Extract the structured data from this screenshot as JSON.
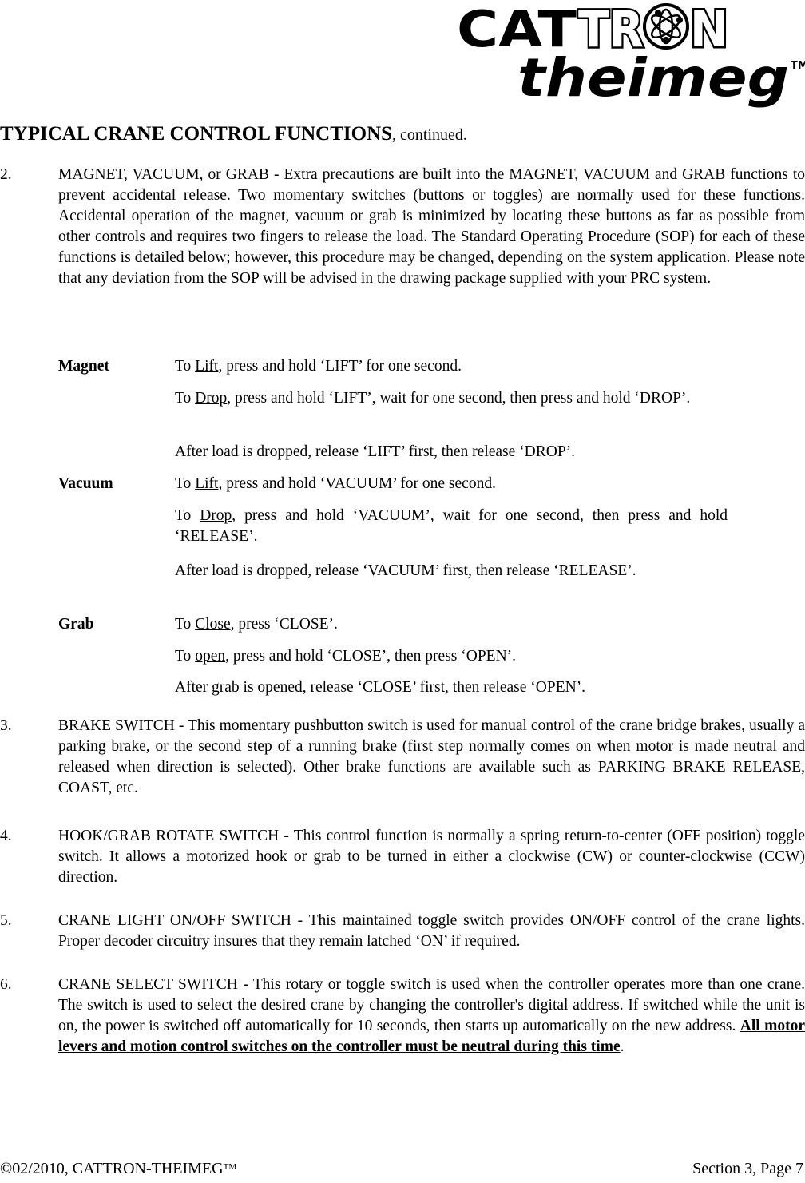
{
  "logo": {
    "line1": "CATTRON",
    "line2": "theimeg",
    "trademark": "TM"
  },
  "heading": {
    "bold": "TYPICAL CRANE CONTROL FUNCTIONS",
    "suffix": ", continued."
  },
  "items": [
    {
      "number": "2.",
      "text": "MAGNET, VACUUM, or GRAB - Extra precautions are built into the MAGNET, VACUUM and GRAB functions to prevent accidental release.  Two momentary switches (buttons or toggles) are normally used for these functions.  Accidental operation of the magnet, vacuum or grab is minimized by locating these buttons as far as possible from other controls and requires two fingers to release the load.  The Standard Operating Procedure (SOP) for each of these functions is detailed below; however, this procedure may be changed, depending on the system application.  Please note that any deviation from the SOP will be advised in the drawing package supplied with your PRC system."
    },
    {
      "number": "3.",
      "text": "BRAKE SWITCH - This momentary pushbutton switch is used for manual control of the crane bridge brakes, usually a parking brake, or the second step of a running brake (first step normally comes on when motor is made neutral and released when direction is selected). Other brake functions are available such as PARKING BRAKE RELEASE, COAST, etc."
    },
    {
      "number": "4.",
      "text": "HOOK/GRAB ROTATE SWITCH - This control function is normally a spring return-to-center (OFF position) toggle switch.  It allows a motorized hook or grab to be turned in either a clockwise (CW) or counter-clockwise (CCW) direction."
    },
    {
      "number": "5.",
      "text": "CRANE LIGHT ON/OFF SWITCH - This maintained toggle switch provides ON/OFF control of the crane lights.  Proper decoder circuitry insures that they remain latched ‘ON’ if required."
    },
    {
      "number": "6.",
      "text": "CRANE SELECT SWITCH - This rotary or toggle switch is used when the controller operates more than one crane. The switch is used to select the desired crane by changing the controller's digital address. If switched while the unit is on, the power is switched off automatically for 10 seconds, then starts up automatically on the new address. ",
      "emphasis": "All motor levers and motion control switches on the controller must be neutral during this time",
      "end": "."
    }
  ],
  "sop": {
    "magnet": {
      "label": "Magnet",
      "steps": [
        {
          "pre": "To ",
          "key": "Lift",
          "post": ", press and hold ‘LIFT’ for one second."
        },
        {
          "pre": "To ",
          "key": "Drop",
          "post": ", press and hold ‘LIFT’, wait for one second, then press and hold  ‘DROP’."
        },
        {
          "pre": "",
          "key": "",
          "post": "After load is dropped, release ‘LIFT’ first, then release ‘DROP’."
        }
      ]
    },
    "vacuum": {
      "label": "Vacuum",
      "steps": [
        {
          "pre": "To ",
          "key": "Lift",
          "post": ", press and hold ‘VACUUM’ for one second."
        },
        {
          "pre": "To ",
          "key": "Drop",
          "post": ", press and hold ‘VACUUM’, wait for one second, then press and hold ‘RELEASE’."
        },
        {
          "pre": "",
          "key": "",
          "post": "After load is dropped, release ‘VACUUM’ first, then release ‘RELEASE’."
        }
      ]
    },
    "grab": {
      "label": "Grab",
      "steps": [
        {
          "pre": "To ",
          "key": "Close",
          "post": ", press ‘CLOSE’."
        },
        {
          "pre": "To ",
          "key": "open",
          "post": ", press and hold ‘CLOSE’, then press ‘OPEN’."
        },
        {
          "pre": "",
          "key": "",
          "post": "After grab is opened, release ‘CLOSE’ first, then release ‘OPEN’."
        }
      ]
    }
  },
  "footer": {
    "copyright": "©02/2010, CATTRON-THEIMEG",
    "trademark": "TM",
    "page": "Section 3, Page 7"
  }
}
